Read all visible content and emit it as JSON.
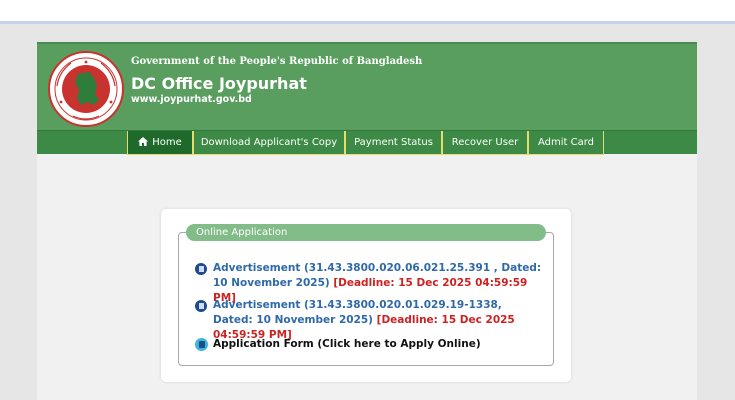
{
  "header": {
    "government_title": "Government of the People's Republic of Bangladesh",
    "office_title": "DC Office Joypurhat",
    "website": "www.joypurhat.gov.bd",
    "seal_icon": "bangladesh-government-seal-icon"
  },
  "nav": {
    "items": [
      {
        "label": "Home",
        "icon": "home-icon"
      },
      {
        "label": "Download Applicant's Copy"
      },
      {
        "label": "Payment Status"
      },
      {
        "label": "Recover User"
      },
      {
        "label": "Admit Card"
      }
    ]
  },
  "panel": {
    "title": "Online Application",
    "advertisements": [
      {
        "text": "Advertisement (31.43.3800.020.06.021.25.391 , Dated: 10 November 2025)",
        "deadline": "[Deadline: 15 Dec 2025 04:59:59 PM]",
        "icon": "pdf-document-icon"
      },
      {
        "text": "Advertisement (31.43.3800.020.01.029.19-1338, Dated: 10 November 2025)",
        "deadline": "[Deadline: 15 Dec 2025 04:59:59 PM]",
        "icon": "pdf-document-icon"
      }
    ],
    "apply": {
      "label": "Application Form (Click here to Apply Online)",
      "icon": "application-form-icon"
    }
  },
  "colors": {
    "header_green": "#5a9e5f",
    "nav_green": "#3c8a45",
    "nav_active": "#1f6a2a",
    "nav_border": "#e6dc6b",
    "link_blue": "#2f69a8",
    "deadline_red": "#cc2222",
    "legend_green": "#82bc88"
  }
}
